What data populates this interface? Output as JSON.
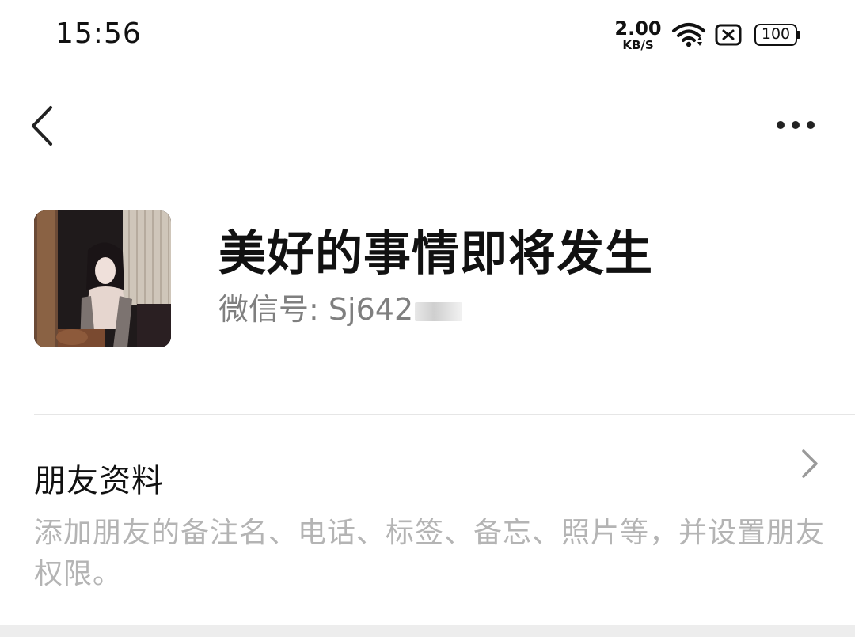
{
  "status_bar": {
    "time": "15:56",
    "net_speed_value": "2.00",
    "net_speed_unit": "KB/S",
    "battery": "100"
  },
  "profile": {
    "display_name": "美好的事情即将发生",
    "wechat_id_label": "微信号:",
    "wechat_id_visible": "Sj642"
  },
  "friend_settings": {
    "title": "朋友资料",
    "description": "添加朋友的备注名、电话、标签、备忘、照片等，并设置朋友权限。"
  },
  "icons": {
    "back": "chevron-left-icon",
    "more": "more-dots-icon",
    "row": "chevron-right-icon",
    "wifi": "wifi-icon",
    "sim": "sim-x-icon",
    "battery": "battery-icon"
  },
  "colors": {
    "text_primary": "#111111",
    "text_secondary": "#7f7f7f",
    "text_hint": "#b4b4b4",
    "divider": "#e6e6e6",
    "background": "#ffffff"
  }
}
